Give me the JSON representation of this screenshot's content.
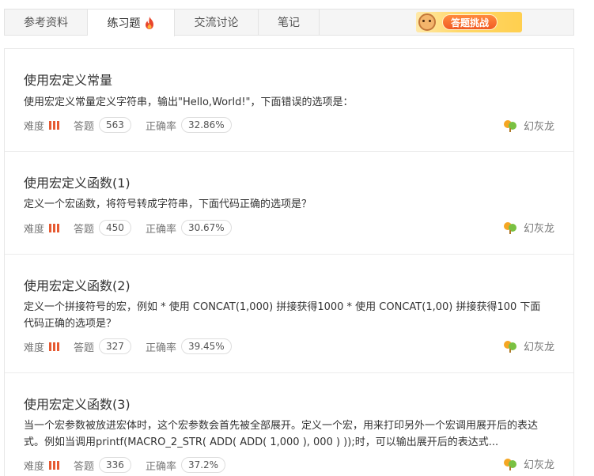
{
  "tabs": [
    {
      "label": "参考资料"
    },
    {
      "label": "练习题",
      "icon": "fire-icon"
    },
    {
      "label": "交流讨论"
    },
    {
      "label": "笔记"
    }
  ],
  "banner": {
    "label": "答题挑战"
  },
  "meta_labels": {
    "difficulty": "难度",
    "answers": "答题",
    "accuracy": "正确率"
  },
  "questions": [
    {
      "title": "使用宏定义常量",
      "desc": "使用宏定义常量定义字符串，输出\"Hello,World!\"，下面错误的选项是：",
      "answers": "563",
      "accuracy": "32.86%",
      "author": "幻灰龙"
    },
    {
      "title": "使用宏定义函数(1)",
      "desc": "定义一个宏函数，将符号转成字符串，下面代码正确的选项是？",
      "answers": "450",
      "accuracy": "30.67%",
      "author": "幻灰龙"
    },
    {
      "title": "使用宏定义函数(2)",
      "desc": "定义一个拼接符号的宏，例如 * 使用 CONCAT(1,000) 拼接获得1000 * 使用 CONCAT(1,00) 拼接获得100 下面代码正确的选项是？",
      "answers": "327",
      "accuracy": "39.45%",
      "author": "幻灰龙"
    },
    {
      "title": "使用宏定义函数(3)",
      "desc": "当一个宏参数被放进宏体时，这个宏参数会首先被全部展开。定义一个宏，用来打印另外一个宏调用展开后的表达式。例如当调用printf(MACRO_2_STR( ADD( ADD( 1,000 ), 000 ) ));时，可以输出展开后的表达式...",
      "answers": "336",
      "accuracy": "37.2%",
      "author": "幻灰龙"
    }
  ],
  "colors": {
    "difficulty_bar": "#e65a32",
    "fire": "#e8452c"
  }
}
